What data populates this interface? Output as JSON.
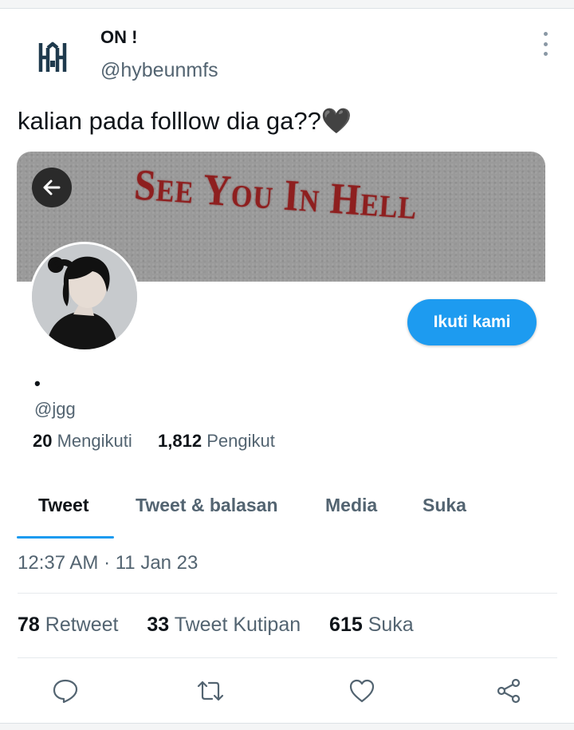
{
  "tweet": {
    "author_name": "ON !",
    "author_handle": "@hybeunmfs",
    "author_logo": "house-h-logo",
    "text": "kalian pada folllow dia ga??🖤",
    "timestamp": "12:37 AM · 11 Jan 23",
    "stats": {
      "retweets_count": "78",
      "retweets_label": "Retweet",
      "quotes_count": "33",
      "quotes_label": "Tweet Kutipan",
      "likes_count": "615",
      "likes_label": "Suka"
    },
    "actions": [
      "reply-icon",
      "retweet-icon",
      "like-icon",
      "share-icon"
    ],
    "more_icon": "more-vertical-icon"
  },
  "profile_card": {
    "banner_text": "See You In Hell",
    "back_icon": "arrow-left-icon",
    "follow_label": "Ikuti kami",
    "name": "•",
    "handle": "@jgg",
    "following_count": "20",
    "following_label": "Mengikuti",
    "followers_count": "1,812",
    "followers_label": "Pengikut",
    "tabs": [
      {
        "label": "Tweet",
        "active": true
      },
      {
        "label": "Tweet & balasan",
        "active": false
      },
      {
        "label": "Media",
        "active": false
      },
      {
        "label": "Suka",
        "active": false
      }
    ]
  },
  "colors": {
    "accent": "#1d9bf0",
    "text_primary": "#0f1419",
    "text_secondary": "#536471",
    "banner_text": "#8e1f1f",
    "logo": "#1f3a4d"
  }
}
